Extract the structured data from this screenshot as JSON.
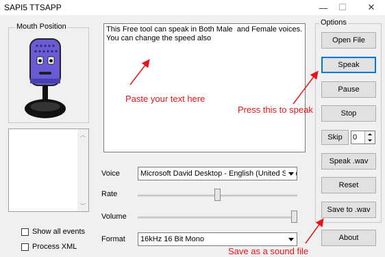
{
  "window": {
    "title": "SAPI5 TTSAPP",
    "minimize_glyph": "—",
    "maximize_glyph": "☐",
    "close_glyph": "✕"
  },
  "mouth": {
    "label": "Mouth Position",
    "icon": "microphone-character-icon"
  },
  "text_input": {
    "value": "This Free tool can speak in Both Male  and Female voices.\nYou can change the speed also"
  },
  "labels": {
    "voice": "Voice",
    "rate": "Rate",
    "volume": "Volume",
    "format": "Format"
  },
  "voice": {
    "selected": "Microsoft David Desktop - English (United States)"
  },
  "format": {
    "selected": "16kHz 16 Bit Mono"
  },
  "rate": {
    "level": 0.5
  },
  "volume": {
    "level": 1.0
  },
  "checkboxes": {
    "show_all_events": "Show all events",
    "process_xml": "Process XML"
  },
  "options": {
    "label": "Options",
    "open_file": "Open File",
    "speak": "Speak",
    "pause": "Pause",
    "stop": "Stop",
    "skip": "Skip",
    "skip_value": "0",
    "speak_wav": "Speak .wav",
    "reset": "Reset",
    "save_to_wav": "Save to .wav",
    "about": "About"
  },
  "annotations": {
    "paste": "Paste your text here",
    "press": "Press this to speak",
    "save": "Save as a sound file"
  },
  "colors": {
    "annotation": "#e8141c",
    "focus": "#0078d7",
    "mascot": "#6b5bd6"
  }
}
